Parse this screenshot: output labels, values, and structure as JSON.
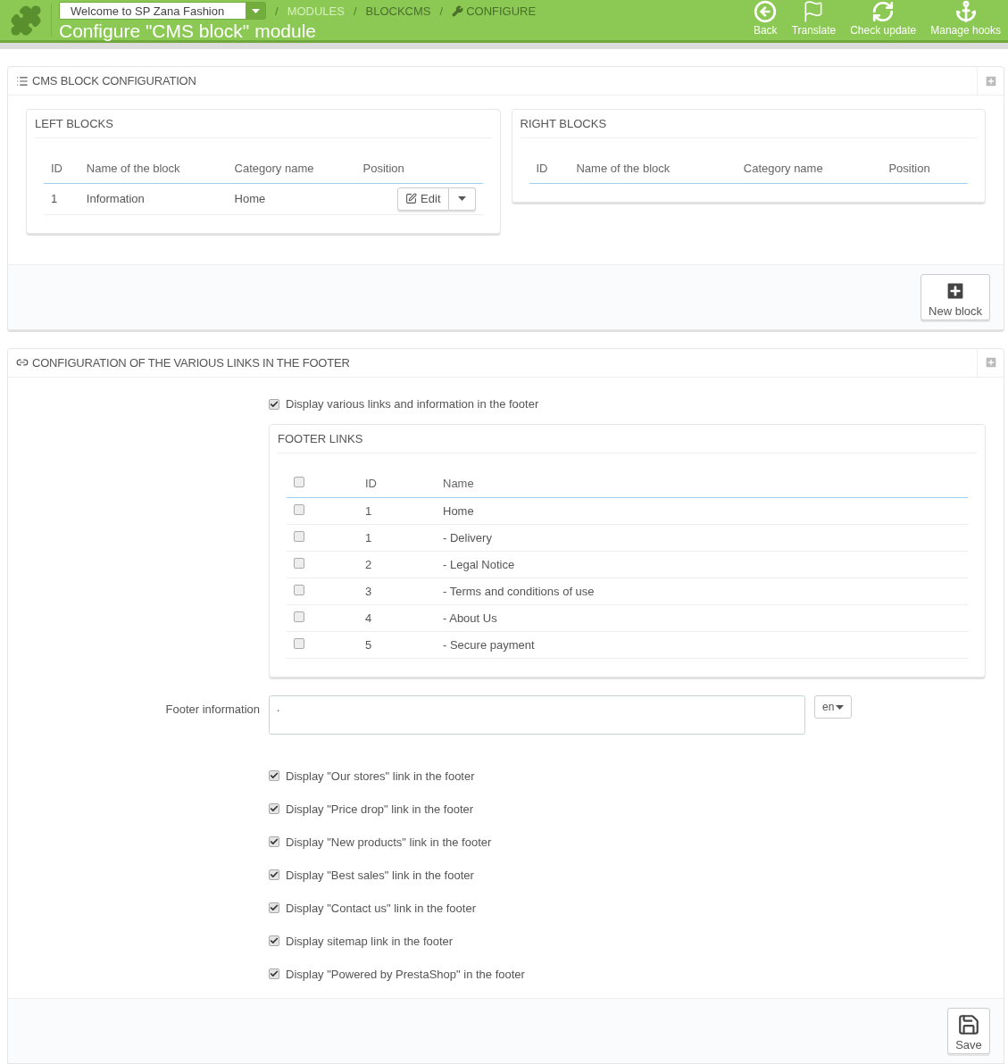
{
  "header": {
    "shop_select": {
      "value": "Welcome to SP Zana Fashion"
    },
    "breadcrumb_separator": "/",
    "breadcrumb": [
      {
        "label": "MODULES",
        "kind": "link"
      },
      {
        "label": "BLOCKCMS",
        "kind": "text"
      },
      {
        "label": "CONFIGURE",
        "kind": "current"
      }
    ],
    "title": "Configure \"CMS block\" module",
    "toolbar": [
      {
        "label": "Back",
        "kind": "back"
      },
      {
        "label": "Translate",
        "kind": "translate"
      },
      {
        "label": "Check update",
        "kind": "update"
      },
      {
        "label": "Manage hooks",
        "kind": "hooks"
      }
    ]
  },
  "cms_block_panel": {
    "title": "CMS BLOCK CONFIGURATION",
    "blocks": [
      {
        "title": "LEFT BLOCKS",
        "columns": [
          "ID",
          "Name of the block",
          "Category name",
          "Position"
        ],
        "rows": [
          {
            "id": "1",
            "name": "Information",
            "category": "Home",
            "action": "Edit"
          }
        ]
      },
      {
        "title": "RIGHT BLOCKS",
        "columns": [
          "ID",
          "Name of the block",
          "Category name",
          "Position"
        ]
      }
    ],
    "footer_button": "New block"
  },
  "footer_panel": {
    "title": "CONFIGURATION OF THE VARIOUS LINKS IN THE FOOTER",
    "display_links": {
      "label": "Display various links and information in the footer",
      "checked": true
    },
    "footer_links": {
      "title": "FOOTER LINKS",
      "select_all_checked": false,
      "columns": [
        "ID",
        "Name"
      ],
      "rows": [
        {
          "id": "1",
          "name": "Home",
          "checked": false
        },
        {
          "id": "1",
          "name": "- Delivery",
          "checked": false
        },
        {
          "id": "2",
          "name": "- Legal Notice",
          "checked": false
        },
        {
          "id": "3",
          "name": "- Terms and conditions of use",
          "checked": false
        },
        {
          "id": "4",
          "name": "- About Us",
          "checked": false
        },
        {
          "id": "5",
          "name": "- Secure payment",
          "checked": false
        }
      ]
    },
    "footer_information": {
      "label": "Footer information",
      "value": ".",
      "language": "en"
    },
    "options": [
      {
        "label": "Display \"Our stores\" link in the footer",
        "checked": true
      },
      {
        "label": "Display \"Price drop\" link in the footer",
        "checked": true
      },
      {
        "label": "Display \"New products\" link in the footer",
        "checked": true
      },
      {
        "label": "Display \"Best sales\" link in the footer",
        "checked": true
      },
      {
        "label": "Display \"Contact us\" link in the footer",
        "checked": true
      },
      {
        "label": "Display sitemap link in the footer",
        "checked": true
      },
      {
        "label": "Display \"Powered by PrestaShop\" in the footer",
        "checked": true
      }
    ],
    "footer_button": "Save"
  }
}
